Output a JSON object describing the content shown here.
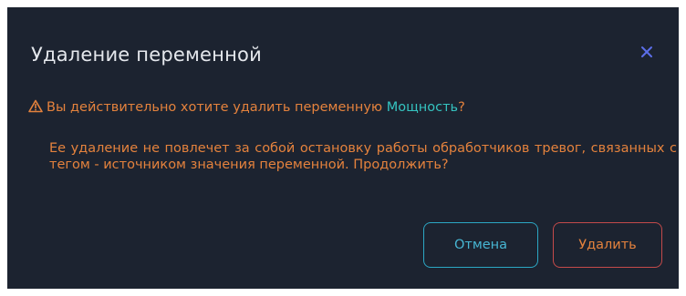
{
  "dialog": {
    "title": "Удаление переменной",
    "warning_prefix": "Вы действительно хотите удалить переменную",
    "variable_name": "Мощность",
    "warning_suffix": "?",
    "message": "Ее удаление не повлечет за собой остановку работы обработчиков тревог, связанных с тегом - источником значения переменной. Продолжить?",
    "cancel_label": "Отмена",
    "delete_label": "Удалить"
  },
  "icons": {
    "close": "close-icon",
    "warning": "warning-triangle-icon"
  },
  "colors": {
    "background": "#1c2330",
    "title": "#e4e7ec",
    "warning_text": "#e4823d",
    "variable_highlight": "#35c3c0",
    "close_icon": "#5b6ee8",
    "cancel_border": "#2ca7c4",
    "delete_border": "#c44a4a"
  }
}
